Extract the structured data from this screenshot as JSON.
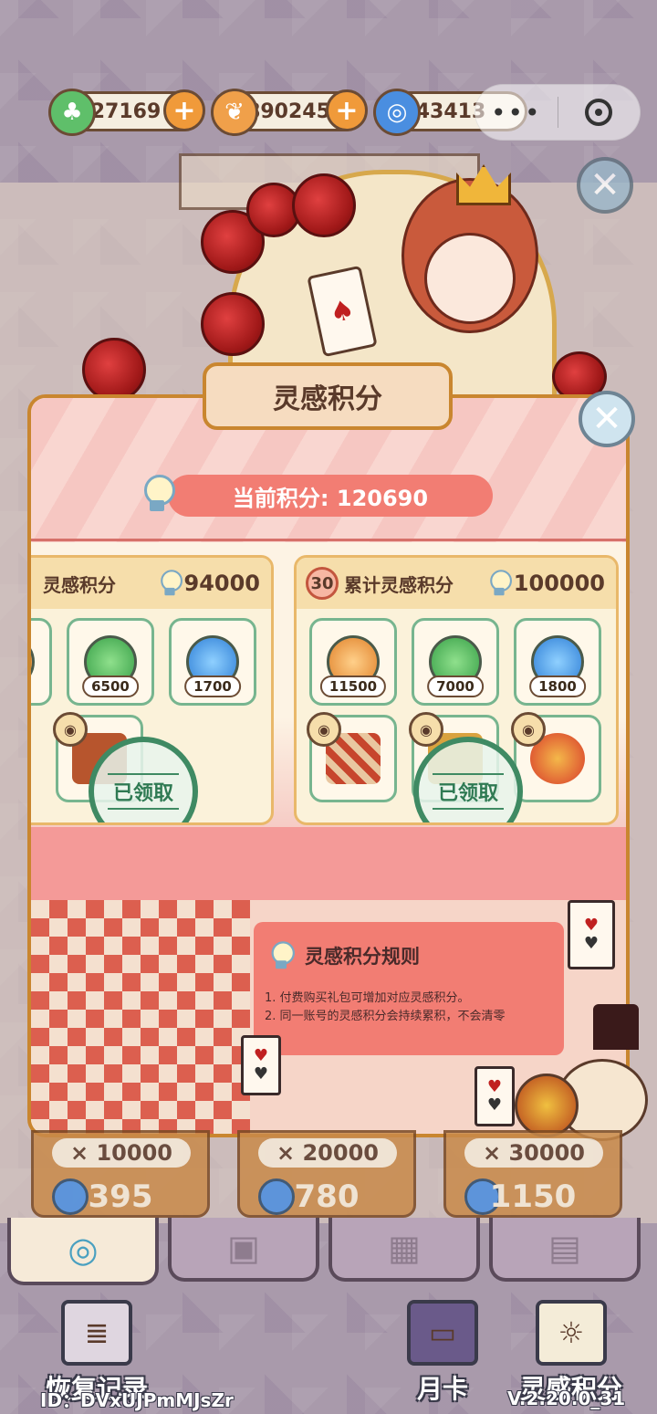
{
  "currencies": [
    {
      "icon": "clover-icon",
      "value": "27169"
    },
    {
      "icon": "shell-icon",
      "value": "890245"
    },
    {
      "icon": "swirl-icon",
      "value": "43413"
    }
  ],
  "capsule": {
    "more": "•••"
  },
  "modal": {
    "title": "灵感积分",
    "current_points_label": "当前积分: 120690",
    "tiers": [
      {
        "badge": "",
        "label": "灵感积分",
        "need": "94000",
        "items": [
          {
            "icon": "clover-icon",
            "qty": "6500"
          },
          {
            "icon": "swirl-icon",
            "qty": "1700"
          }
        ],
        "claimed": "已领取"
      },
      {
        "badge": "30",
        "label": "累计灵感积分",
        "need": "100000",
        "items": [
          {
            "icon": "shell-icon",
            "qty": "11500"
          },
          {
            "icon": "clover-icon",
            "qty": "7000"
          },
          {
            "icon": "swirl-icon",
            "qty": "1800"
          }
        ],
        "claimed": "已领取"
      }
    ],
    "rules": {
      "title": "灵感积分规则",
      "line1": "1. 付费购买礼包可增加对应灵感积分。",
      "line2": "2. 同一账号的灵感积分会持续累积，不会清零"
    }
  },
  "shop": [
    {
      "mult": "× 10000",
      "price": "395"
    },
    {
      "mult": "× 20000",
      "price": "780"
    },
    {
      "mult": "× 30000",
      "price": "1150"
    }
  ],
  "bottom": {
    "restore": "恢复记录",
    "monthly": "月卡",
    "inspiration": "灵感积分",
    "id": "ID：DVxUJPmMJsZr",
    "version": "V.2.20.0_31"
  },
  "colors": {
    "accent": "#f27d73",
    "frame": "#c9862f",
    "claimed": "#3f8a63"
  }
}
